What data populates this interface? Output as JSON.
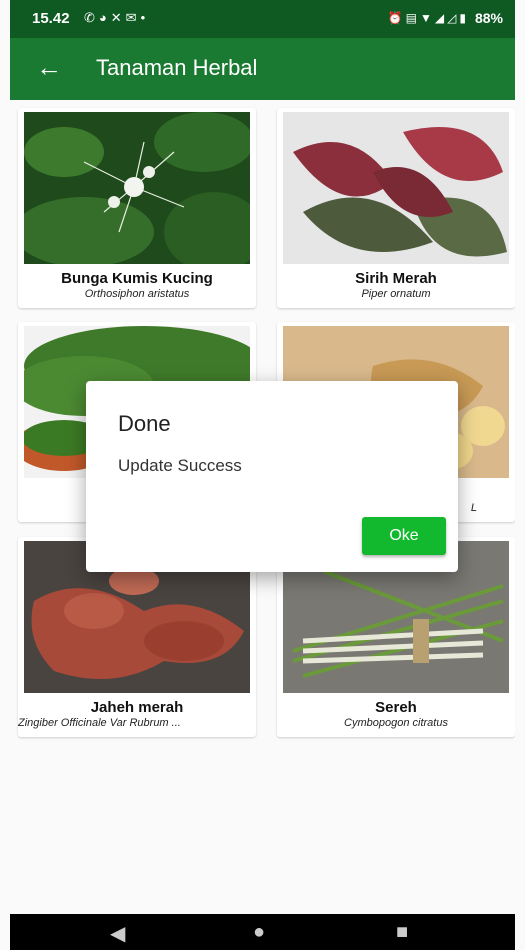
{
  "status": {
    "time": "15.42",
    "battery": "88%",
    "left_icons": [
      "whatsapp-icon",
      "messenger-icon",
      "gamepad-icon",
      "mail-icon",
      "dot-icon"
    ],
    "right_icons": [
      "alarm-icon",
      "volte-icon",
      "wifi-icon",
      "signal-icon",
      "signal-empty-icon",
      "battery-icon"
    ]
  },
  "appbar": {
    "title": "Tanaman Herbal",
    "back_icon": "arrow-left-icon"
  },
  "plants": [
    {
      "name": "Bunga Kumis Kucing",
      "latin": "Orthosiphon aristatus"
    },
    {
      "name": "Sirih Merah",
      "latin": "Piper ornatum"
    },
    {
      "name": "",
      "latin": ""
    },
    {
      "name": "",
      "latin": "L"
    },
    {
      "name": "Jaheh merah",
      "latin": "Zingiber Officinale Var Rubrum ..."
    },
    {
      "name": "Sereh",
      "latin": "Cymbopogon citratus"
    }
  ],
  "dialog": {
    "title": "Done",
    "message": "Update Success",
    "ok_label": "Oke"
  },
  "nav": {
    "back": "◀",
    "home": "●",
    "recents": "■"
  },
  "colors": {
    "status_bar": "#0f5a23",
    "app_bar": "#1a7a32",
    "ok_button": "#12b82e"
  }
}
